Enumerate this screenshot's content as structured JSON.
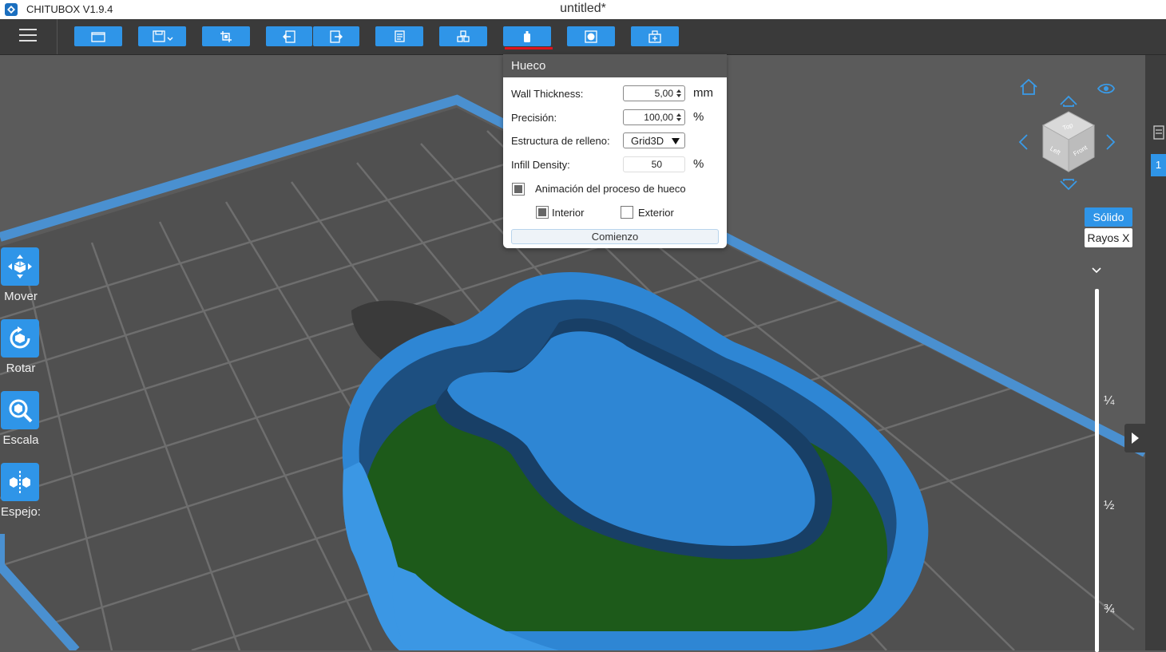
{
  "titlebar": {
    "app_name": "CHITUBOX V1.9.4",
    "document_title": "untitled*"
  },
  "toolbar": {
    "buttons": [
      {
        "name": "open-file-button",
        "icon": "folder-icon"
      },
      {
        "name": "save-button",
        "icon": "save-icon",
        "has_dropdown": true
      },
      {
        "name": "screenshot-button",
        "icon": "crop-icon"
      },
      {
        "name": "undo-button",
        "icon": "undo-icon"
      },
      {
        "name": "redo-button",
        "icon": "redo-icon"
      },
      {
        "name": "layout-button",
        "icon": "document-icon"
      },
      {
        "name": "supports-button",
        "icon": "cubes-icon"
      },
      {
        "name": "hollow-button",
        "icon": "hollow-icon",
        "active": true
      },
      {
        "name": "dig-hole-button",
        "icon": "hole-icon"
      },
      {
        "name": "add-box-button",
        "icon": "add-box-icon"
      }
    ]
  },
  "left_tools": [
    {
      "label": "Mover",
      "icon": "move-icon"
    },
    {
      "label": "Rotar",
      "icon": "rotate-icon"
    },
    {
      "label": "Escala",
      "icon": "scale-icon"
    },
    {
      "label": "Espejo:",
      "icon": "mirror-icon"
    }
  ],
  "hollow_dialog": {
    "title": "Hueco",
    "wall_thickness": {
      "label": "Wall Thickness:",
      "value": "5,00",
      "unit": "mm"
    },
    "precision": {
      "label": "Precisión:",
      "value": "100,00",
      "unit": "%"
    },
    "infill_structure": {
      "label": "Estructura de relleno:",
      "selected": "Grid3D"
    },
    "infill_density": {
      "label": "Infill Density:",
      "value": "50",
      "unit": "%"
    },
    "animation": {
      "label": "Animación del proceso de hueco",
      "checked": true
    },
    "interior": {
      "label": "Interior",
      "checked": true
    },
    "exterior": {
      "label": "Exterior",
      "checked": false
    },
    "start_button": "Comienzo"
  },
  "view_cube": {
    "faces": [
      "Top",
      "Left",
      "Front"
    ]
  },
  "display_modes": {
    "solid": "Sólido",
    "xray": "Rayos X",
    "active": "solid"
  },
  "layer_slider": {
    "fractions": [
      "¼",
      "½",
      "¾"
    ]
  },
  "right_panel": {
    "tab_label": "1"
  },
  "colors": {
    "accent": "#2f95e8",
    "model_blue": "#2e86d4",
    "infill_green": "#1d5a1a",
    "annotation_red": "#e0141e",
    "plate_border": "#4a90d0"
  }
}
